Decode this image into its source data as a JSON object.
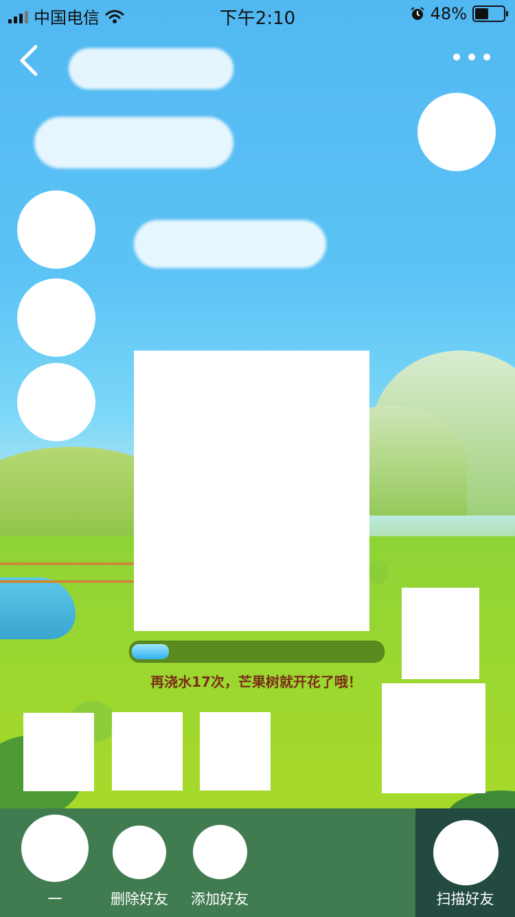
{
  "status_bar": {
    "carrier": "中国电信",
    "time": "下午2:10",
    "battery_percent": "48%",
    "battery_level": 0.48,
    "icons": [
      "signal-icon",
      "wifi-icon",
      "alarm-icon",
      "battery-icon"
    ]
  },
  "nav": {
    "back_icon": "chevron-left-icon",
    "more_icon": "more-dots-icon"
  },
  "progress": {
    "value": 0.15,
    "message": "再浇水17次，芒果树就开花了哦！"
  },
  "bottom_bar": {
    "items": [
      {
        "label": "一"
      },
      {
        "label": "删除好友"
      },
      {
        "label": "添加好友"
      },
      {
        "label": "扫描好友"
      }
    ]
  },
  "colors": {
    "sky": "#52b8f2",
    "grass": "#a4d92b",
    "bottom_bar": "#417c51",
    "scan_panel": "#224a40",
    "progress_track": "#5b8b1f",
    "progress_fill": "#2fb2ec",
    "message_text": "#7a2d18"
  }
}
